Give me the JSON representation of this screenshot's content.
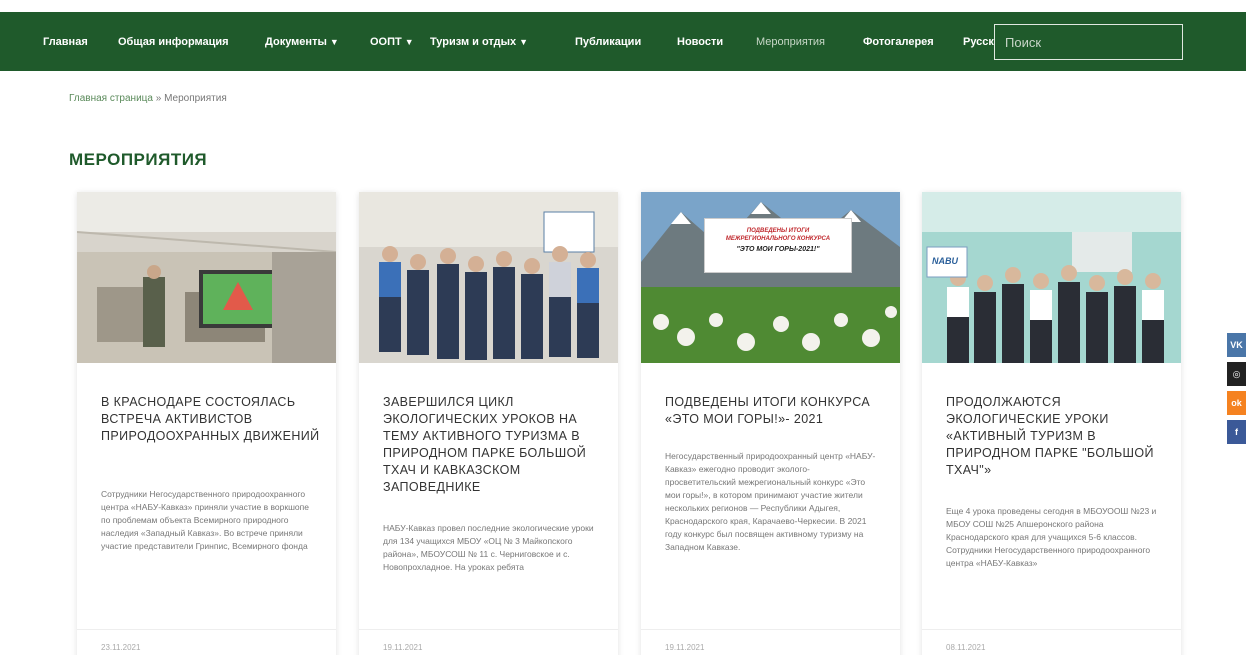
{
  "nav": {
    "items": [
      {
        "label": "Главная",
        "dropdown": false
      },
      {
        "label": "Общая информация",
        "dropdown": false
      },
      {
        "label": "Документы",
        "dropdown": true
      },
      {
        "label": "ООПТ",
        "dropdown": true
      },
      {
        "label": "Туризм и отдых",
        "dropdown": true
      },
      {
        "label": "Публикации",
        "dropdown": false
      },
      {
        "label": "Новости",
        "dropdown": false
      },
      {
        "label": "Мероприятия",
        "dropdown": false,
        "active": true
      },
      {
        "label": "Фотогалерея",
        "dropdown": false
      }
    ],
    "language": "Русский",
    "search_placeholder": "Поиск",
    "bg_color": "#1f5a2b"
  },
  "breadcrumb": {
    "home": "Главная страница",
    "separator": "»",
    "current": "Мероприятия"
  },
  "page_title": "МЕРОПРИЯТИЯ",
  "cards": [
    {
      "title": "В КРАСНОДАРЕ СОСТОЯЛАСЬ ВСТРЕЧА АКТИВИСТОВ ПРИРОДООХРАННЫХ ДВИЖЕНИЙ",
      "excerpt": "Сотрудники Негосударственного природоохранного центра «НАБУ-Кавказ» приняли участие в воркшопе по проблемам объекта Всемирного природного наследия «Западный Кавказ». Во встрече приняли участие представители Гринпис, Всемирного фонда",
      "date": "23.11.2021",
      "image_kind": "classroom-screen"
    },
    {
      "title": "ЗАВЕРШИЛСЯ ЦИКЛ ЭКОЛОГИЧЕСКИХ УРОКОВ НА ТЕМУ АКТИВНОГО ТУРИЗМА В ПРИРОДНОМ ПАРКЕ БОЛЬШОЙ ТХАЧ И КАВКАЗСКОМ ЗАПОВЕДНИКЕ",
      "excerpt": "НАБУ-Кавказ провел последние экологические уроки для 134 учащихся МБОУ «ОЦ № 3 Майкопского района», МБОУСОШ № 11 с. Черниговское и с. Новопрохладное. На уроках ребята",
      "date": "19.11.2021",
      "image_kind": "group-photo"
    },
    {
      "title": "ПОДВЕДЕНЫ ИТОГИ КОНКУРСА «ЭТО МОИ ГОРЫ!»- 2021",
      "excerpt": "Негосударственный природоохранный центр «НАБУ-Кавказ» ежегодно проводит эколого-просветительский межрегиональный конкурс «Это мои горы!», в котором принимают участие жители нескольких регионов — Республики Адыгея, Краснодарского края, Карачаево-Черкесии. В 2021 году конкурс был посвящен активному туризму на Западном Кавказе.",
      "date": "19.11.2021",
      "image_kind": "mountain-banner",
      "banner_lines": [
        "ПОДВЕДЕНЫ ИТОГИ",
        "МЕЖРЕГИОНАЛЬНОГО КОНКУРСА",
        "\"ЭТО МОИ ГОРЫ-2021!\""
      ]
    },
    {
      "title": "ПРОДОЛЖАЮТСЯ ЭКОЛОГИЧЕСКИЕ УРОКИ «АКТИВНЫЙ ТУРИЗМ В ПРИРОДНОМ ПАРКЕ \"БОЛЬШОЙ ТХАЧ\"»",
      "excerpt": "Еще 4 урока проведены сегодня в МБОУООШ №23 и МБОУ СОШ №25 Апшеронского района Краснодарского края для учащихся 5-6 классов. Сотрудники Негосударственного природоохранного центра «НАБУ-Кавказ»",
      "date": "08.11.2021",
      "image_kind": "class-photo",
      "image_logo": "NABU"
    }
  ],
  "social": [
    {
      "icon": "vk-icon",
      "label": "VK",
      "color": "#4a76a8"
    },
    {
      "icon": "instagram-icon",
      "label": "◎",
      "color": "#222222"
    },
    {
      "icon": "odnoklassniki-icon",
      "label": "ok",
      "color": "#f58220"
    },
    {
      "icon": "facebook-icon",
      "label": "f",
      "color": "#3b5998"
    }
  ]
}
